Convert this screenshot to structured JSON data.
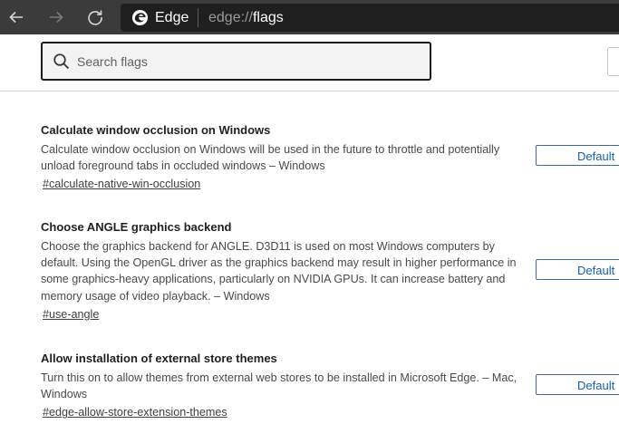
{
  "browser": {
    "name": "Edge",
    "url_scheme": "edge://",
    "url_host": "flags"
  },
  "search": {
    "placeholder": "Search flags"
  },
  "flags": [
    {
      "title": "Calculate window occlusion on Windows",
      "description": "Calculate window occlusion on Windows will be used in the future to throttle and potentially unload foreground tabs in occluded windows – Windows",
      "link": "#calculate-native-win-occlusion",
      "value": "Default"
    },
    {
      "title": "Choose ANGLE graphics backend",
      "description": "Choose the graphics backend for ANGLE. D3D11 is used on most Windows computers by default. Using the OpenGL driver as the graphics backend may result in higher performance in some graphics-heavy applications, particularly on NVIDIA GPUs. It can increase battery and memory usage of video playback. – Windows",
      "link": "#use-angle",
      "value": "Default"
    },
    {
      "title": "Allow installation of external store themes",
      "description": "Turn this on to allow themes from external web stores to be installed in Microsoft Edge. – Mac, Windows",
      "link": "#edge-allow-store-extension-themes",
      "value": "Default"
    }
  ],
  "colors": {
    "toolbar": "#3b3b3b",
    "address_bar": "#1f1f1f",
    "accent": "#1560a8"
  },
  "icons": [
    "back-icon",
    "forward-icon",
    "refresh-icon",
    "edge-logo-icon",
    "search-icon"
  ]
}
